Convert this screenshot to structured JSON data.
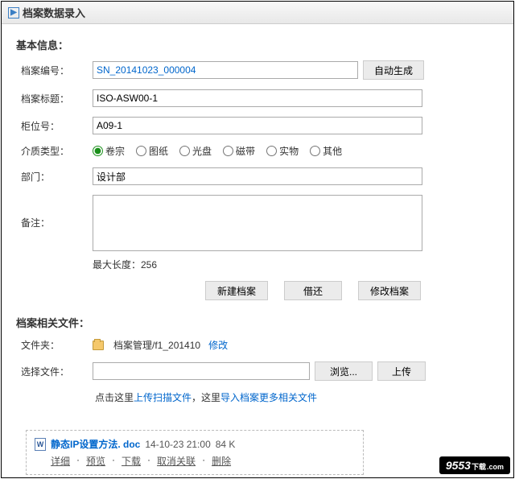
{
  "header": {
    "title": "档案数据录入"
  },
  "section_basic": "基本信息：",
  "labels": {
    "record_no": "档案编号：",
    "title": "档案标题：",
    "cabinet": "柜位号：",
    "media": "介质类型：",
    "dept": "部门：",
    "note": "备注：",
    "folder": "文件夹：",
    "select_file": "选择文件："
  },
  "values": {
    "record_no": "SN_20141023_000004",
    "title": "ISO-ASW00-1",
    "cabinet": "A09-1",
    "dept": "设计部",
    "note": ""
  },
  "buttons": {
    "auto_gen": "自动生成",
    "new_archive": "新建档案",
    "borrow": "借还",
    "modify": "修改档案",
    "browse": "浏览...",
    "upload": "上传"
  },
  "media_options": [
    "卷宗",
    "图纸",
    "光盘",
    "磁带",
    "实物",
    "其他"
  ],
  "maxlen": "最大长度：256",
  "section_files": "档案相关文件：",
  "folder_path": "档案管理/f1_201410",
  "modify_link": "修改",
  "hint": {
    "pre1": "点击这里",
    "link1": "上传扫描文件",
    "mid": "，这里",
    "link2": "导入档案更多相关文件"
  },
  "file": {
    "name": "静态IP设置方法. doc",
    "time": "14-10-23 21:00",
    "size": "84 K",
    "actions": [
      "详细",
      "预览",
      "下载",
      "取消关联",
      "删除"
    ]
  },
  "watermark": {
    "main": "9553",
    "sub": "下载"
  }
}
